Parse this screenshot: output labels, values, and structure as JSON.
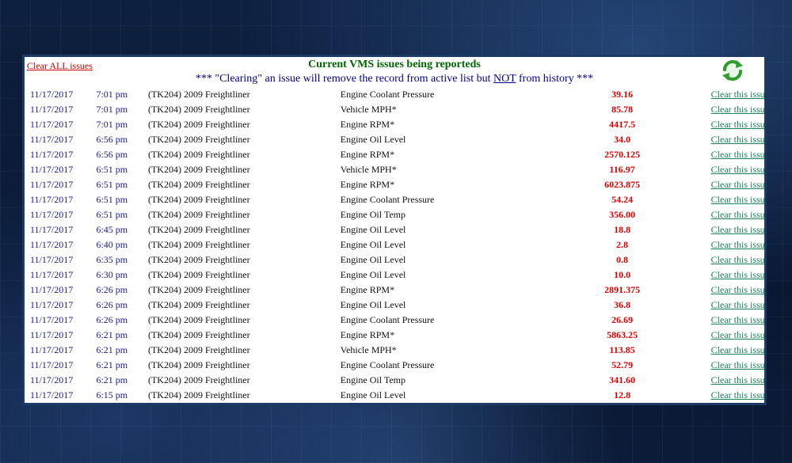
{
  "header": {
    "clear_all_label": "Clear ALL issues",
    "title": "Current VMS issues being reporteds",
    "subtitle_prefix": "*** \"Clearing\" an issue will remove the record from active list but ",
    "subtitle_emphasis": "NOT",
    "subtitle_suffix": " from history ***",
    "refresh_icon": "refresh-icon"
  },
  "colors": {
    "title": "#006600",
    "subtitle": "#00008b",
    "value": "#e00000",
    "link": "#1a7f5a",
    "clear_all": "#cc0000",
    "panel_border": "#1c3a66"
  },
  "row_action_label": "Clear this issue",
  "issues": [
    {
      "date": "11/17/2017",
      "time": "7:01 pm",
      "vehicle": "(TK204) 2009 Freightliner",
      "parameter": "Engine Coolant Pressure",
      "value": "39.16",
      "action": "Clear this issue"
    },
    {
      "date": "11/17/2017",
      "time": "7:01 pm",
      "vehicle": "(TK204) 2009 Freightliner",
      "parameter": "Vehicle MPH*",
      "value": "85.78",
      "action": "Clear this issue"
    },
    {
      "date": "11/17/2017",
      "time": "7:01 pm",
      "vehicle": "(TK204) 2009 Freightliner",
      "parameter": "Engine RPM*",
      "value": "4417.5",
      "action": "Clear this issue"
    },
    {
      "date": "11/17/2017",
      "time": "6:56 pm",
      "vehicle": "(TK204) 2009 Freightliner",
      "parameter": "Engine Oil Level",
      "value": "34.0",
      "action": "Clear this issue"
    },
    {
      "date": "11/17/2017",
      "time": "6:56 pm",
      "vehicle": "(TK204) 2009 Freightliner",
      "parameter": "Engine RPM*",
      "value": "2570.125",
      "action": "Clear this issue"
    },
    {
      "date": "11/17/2017",
      "time": "6:51 pm",
      "vehicle": "(TK204) 2009 Freightliner",
      "parameter": "Vehicle MPH*",
      "value": "116.97",
      "action": "Clear this issue"
    },
    {
      "date": "11/17/2017",
      "time": "6:51 pm",
      "vehicle": "(TK204) 2009 Freightliner",
      "parameter": "Engine RPM*",
      "value": "6023.875",
      "action": "Clear this issue"
    },
    {
      "date": "11/17/2017",
      "time": "6:51 pm",
      "vehicle": "(TK204) 2009 Freightliner",
      "parameter": "Engine Coolant Pressure",
      "value": "54.24",
      "action": "Clear this issue"
    },
    {
      "date": "11/17/2017",
      "time": "6:51 pm",
      "vehicle": "(TK204) 2009 Freightliner",
      "parameter": "Engine Oil Temp",
      "value": "356.00",
      "action": "Clear this issue"
    },
    {
      "date": "11/17/2017",
      "time": "6:45 pm",
      "vehicle": "(TK204) 2009 Freightliner",
      "parameter": "Engine Oil Level",
      "value": "18.8",
      "action": "Clear this issue"
    },
    {
      "date": "11/17/2017",
      "time": "6:40 pm",
      "vehicle": "(TK204) 2009 Freightliner",
      "parameter": "Engine Oil Level",
      "value": "2.8",
      "action": "Clear this issue"
    },
    {
      "date": "11/17/2017",
      "time": "6:35 pm",
      "vehicle": "(TK204) 2009 Freightliner",
      "parameter": "Engine Oil Level",
      "value": "0.8",
      "action": "Clear this issue"
    },
    {
      "date": "11/17/2017",
      "time": "6:30 pm",
      "vehicle": "(TK204) 2009 Freightliner",
      "parameter": "Engine Oil Level",
      "value": "10.0",
      "action": "Clear this issue"
    },
    {
      "date": "11/17/2017",
      "time": "6:26 pm",
      "vehicle": "(TK204) 2009 Freightliner",
      "parameter": "Engine RPM*",
      "value": "2891.375",
      "action": "Clear this issue"
    },
    {
      "date": "11/17/2017",
      "time": "6:26 pm",
      "vehicle": "(TK204) 2009 Freightliner",
      "parameter": "Engine Oil Level",
      "value": "36.8",
      "action": "Clear this issue"
    },
    {
      "date": "11/17/2017",
      "time": "6:26 pm",
      "vehicle": "(TK204) 2009 Freightliner",
      "parameter": "Engine Coolant Pressure",
      "value": "26.69",
      "action": "Clear this issue"
    },
    {
      "date": "11/17/2017",
      "time": "6:21 pm",
      "vehicle": "(TK204) 2009 Freightliner",
      "parameter": "Engine RPM*",
      "value": "5863.25",
      "action": "Clear this issue"
    },
    {
      "date": "11/17/2017",
      "time": "6:21 pm",
      "vehicle": "(TK204) 2009 Freightliner",
      "parameter": "Vehicle MPH*",
      "value": "113.85",
      "action": "Clear this issue"
    },
    {
      "date": "11/17/2017",
      "time": "6:21 pm",
      "vehicle": "(TK204) 2009 Freightliner",
      "parameter": "Engine Coolant Pressure",
      "value": "52.79",
      "action": "Clear this issue"
    },
    {
      "date": "11/17/2017",
      "time": "6:21 pm",
      "vehicle": "(TK204) 2009 Freightliner",
      "parameter": "Engine Oil Temp",
      "value": "341.60",
      "action": "Clear this issue"
    },
    {
      "date": "11/17/2017",
      "time": "6:15 pm",
      "vehicle": "(TK204) 2009 Freightliner",
      "parameter": "Engine Oil Level",
      "value": "12.8",
      "action": "Clear this issue"
    }
  ]
}
